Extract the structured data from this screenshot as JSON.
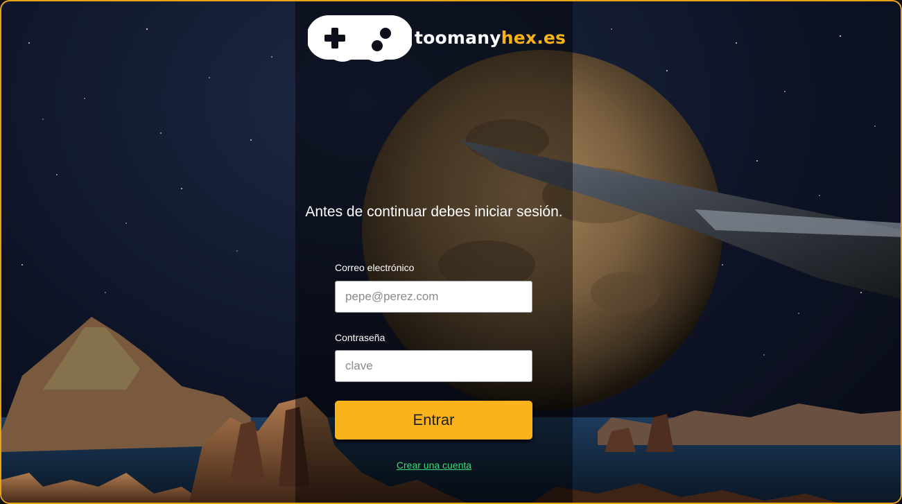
{
  "brand": {
    "name_part1": "toomany",
    "name_part2": "hex.es",
    "logo_icon": "gamepad-icon"
  },
  "login": {
    "intro_text": "Antes de continuar debes iniciar sesión.",
    "email_label": "Correo electrónico",
    "email_placeholder": "pepe@perez.com",
    "email_value": "",
    "password_label": "Contraseña",
    "password_placeholder": "clave",
    "password_value": "",
    "submit_label": "Entrar",
    "signup_link": "Crear una cuenta"
  },
  "theme": {
    "accent": "#f9b21a",
    "frame_border": "#e8a317",
    "link": "#3ddc7a"
  }
}
